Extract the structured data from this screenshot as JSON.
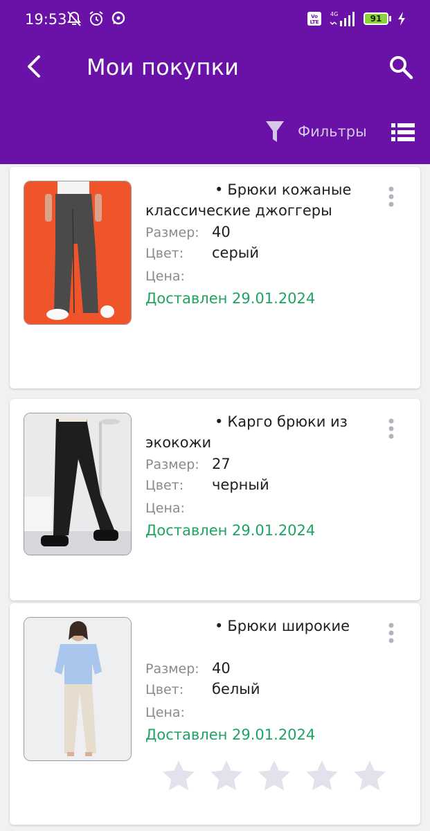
{
  "status_bar": {
    "time": "19:53",
    "battery": "91",
    "network": "4G",
    "volte": "Vo LTE",
    "icons": [
      "notifications-off-icon",
      "alarm-icon",
      "chat-icon",
      "volte-icon",
      "signal-icon",
      "battery-icon",
      "charging-icon"
    ]
  },
  "header": {
    "title": "Мои покупки",
    "filters_label": "Фильтры",
    "background_color": "#6a12a8",
    "icons": [
      "back-arrow-icon",
      "search-icon",
      "filter-icon",
      "list-view-icon"
    ]
  },
  "labels": {
    "size": "Размер:",
    "color": "Цвет:",
    "price": "Цена:"
  },
  "purchases": [
    {
      "title": "Брюки кожаные классические джоггеры",
      "size": "40",
      "color": "серый",
      "price": "",
      "status": "Доставлен 29.01.2024",
      "image": "Бежевые кожаные брюки на оранжевом фоне"
    },
    {
      "title": "Карго брюки из экокожи",
      "size": "27",
      "color": "черный",
      "price": "",
      "status": "Доставлен 29.01.2024",
      "image": "Черные кожаные брюки карго на светлом фоне"
    },
    {
      "title": "Брюки широкие",
      "size": "40",
      "color": "белый",
      "price": "",
      "status": "Доставлен 29.01.2024",
      "image": "Светлые широкие брюки с голубой рубашкой",
      "rating": 0,
      "rating_max": 5
    }
  ],
  "colors": {
    "accent": "#6a12a8",
    "delivered": "#1fa363",
    "star_empty": "#e2e2ec"
  }
}
